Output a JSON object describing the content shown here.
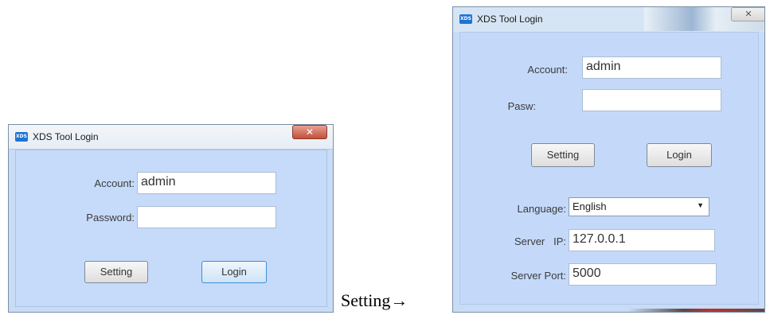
{
  "left_window": {
    "title": "XDS Tool Login",
    "icon_text": "XDS",
    "close_glyph": "✕",
    "account_label": "Account:",
    "account_value": "admin",
    "password_label": "Password:",
    "password_value": "",
    "setting_button": "Setting",
    "login_button": "Login"
  },
  "caption": {
    "text": "Setting→"
  },
  "right_window": {
    "title": "XDS Tool Login",
    "icon_text": "XDS",
    "close_glyph": "✕",
    "account_label": "Account:",
    "account_value": "admin",
    "password_label": "Pasw:",
    "password_value": "",
    "setting_button": "Setting",
    "login_button": "Login",
    "language_label": "Language:",
    "language_value": "English",
    "server_ip_label": "Server   IP:",
    "server_ip_value": "127.0.0.1",
    "server_port_label": "Server Port:",
    "server_port_value": "5000"
  }
}
